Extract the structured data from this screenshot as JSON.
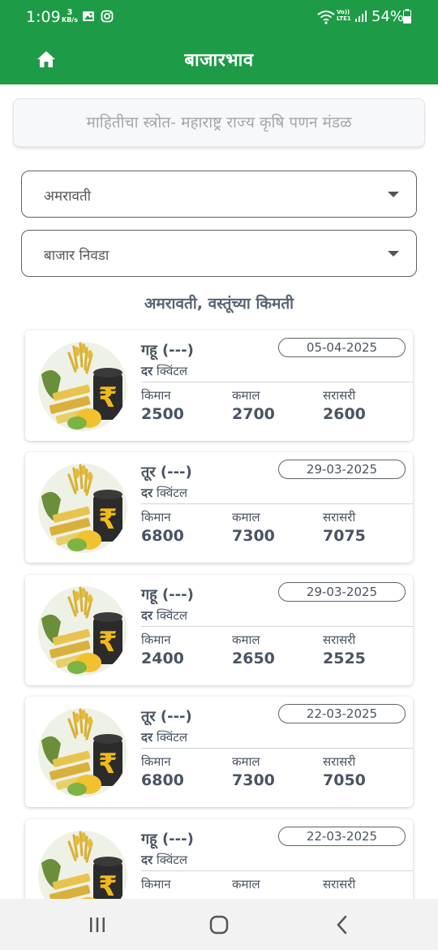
{
  "status_bar": {
    "time": "1:09",
    "net_speed_value": "3",
    "net_speed_unit": "KB/s",
    "lte_label_top": "Vo))",
    "lte_label_bottom": "LTE1",
    "battery": "54%"
  },
  "app_bar": {
    "title": "बाजारभाव"
  },
  "source_note": "माहितीचा स्त्रोत- महाराष्ट्र राज्य कृषि पणन मंडळ",
  "district_select": {
    "value": "अमरावती"
  },
  "market_select": {
    "placeholder": "बाजार निवडा"
  },
  "section_heading": "अमरावती, वस्तूंच्या किमती",
  "labels": {
    "rate": "दर",
    "unit": "क्विंटल",
    "min": "किमान",
    "max": "कमाल",
    "avg": "सरासरी"
  },
  "prices": [
    {
      "name": "गहू (---)",
      "date": "05-04-2025",
      "min": "2500",
      "max": "2700",
      "avg": "2600"
    },
    {
      "name": "तूर (---)",
      "date": "29-03-2025",
      "min": "6800",
      "max": "7300",
      "avg": "7075"
    },
    {
      "name": "गहू (---)",
      "date": "29-03-2025",
      "min": "2400",
      "max": "2650",
      "avg": "2525"
    },
    {
      "name": "तूर (---)",
      "date": "22-03-2025",
      "min": "6800",
      "max": "7300",
      "avg": "7050"
    },
    {
      "name": "गहू (---)",
      "date": "22-03-2025",
      "min": "",
      "max": "",
      "avg": ""
    }
  ],
  "icons": {
    "home": "home-icon",
    "recents": "recents-icon",
    "home_nav": "home-circle-icon",
    "back": "back-icon",
    "commodity": "commodity-image"
  },
  "colors": {
    "primary": "#1e9b46",
    "text": "#4a5462"
  }
}
